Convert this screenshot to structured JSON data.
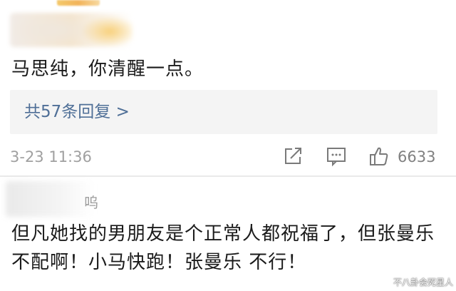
{
  "comment": {
    "text": "马思纯，你清醒一点。",
    "replies_link": "共57条回复 >",
    "timestamp": "3-23 11:36",
    "like_count": "6633"
  },
  "reply": {
    "username_visible_part": "呜",
    "text": "但凡她找的男朋友是个正常人都祝福了，但张曼乐不配啊！小马快跑！张曼乐 不行！"
  },
  "icons": {
    "share": "share-icon",
    "comment": "comment-icon",
    "like": "thumbs-up-icon"
  },
  "watermark": "不八卦会死星人",
  "colors": {
    "link": "#4f6f97",
    "text": "#1a1a1a",
    "meta": "#a0a0a0",
    "reply_box_bg": "#f4f4f4"
  }
}
